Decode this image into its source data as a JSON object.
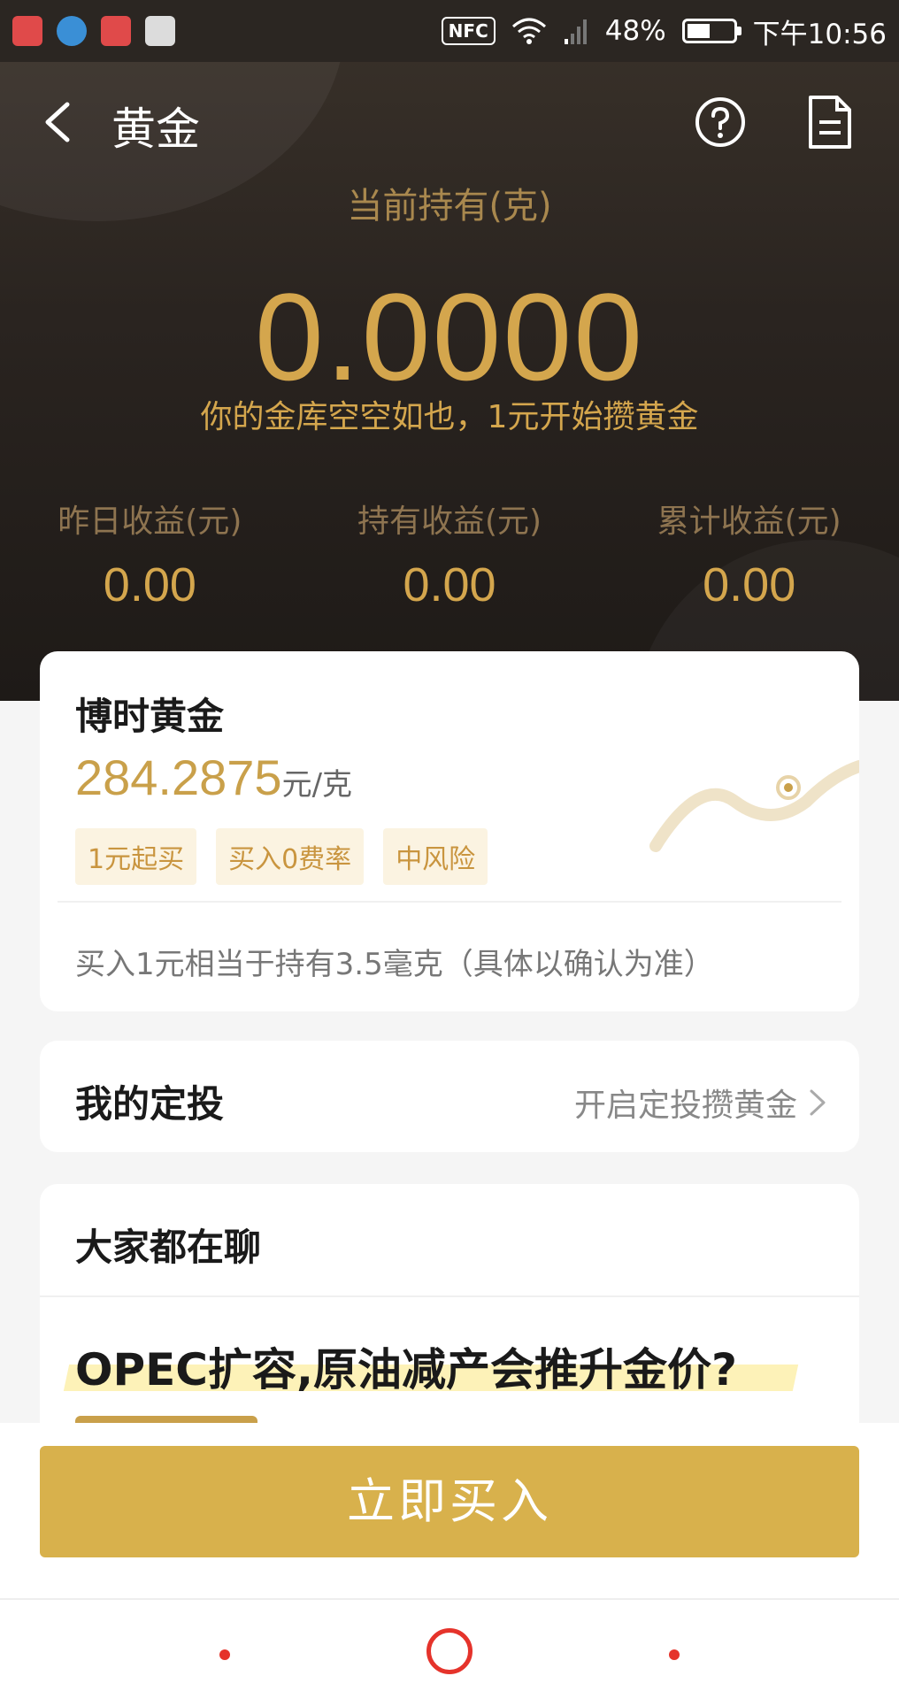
{
  "status_bar": {
    "nfc": "NFC",
    "battery": "48%",
    "time": "下午10:56",
    "app_icon_colors": [
      "#e04a4a",
      "#3a8fd6",
      "#e04a4a",
      "#dcdcdc"
    ]
  },
  "nav": {
    "title": "黄金"
  },
  "holding": {
    "label": "当前持有(克)",
    "value": "0.0000",
    "tip": "你的金库空空如也，1元开始攒黄金"
  },
  "stats": [
    {
      "label": "昨日收益(元)",
      "value": "0.00"
    },
    {
      "label": "持有收益(元)",
      "value": "0.00"
    },
    {
      "label": "累计收益(元)",
      "value": "0.00"
    }
  ],
  "gold_card": {
    "name": "博时黄金",
    "price": "284.2875",
    "unit": "元/克",
    "tags": [
      "1元起买",
      "买入0费率",
      "中风险"
    ],
    "note": "买入1元相当于持有3.5毫克（具体以确认为准）"
  },
  "invest": {
    "title": "我的定投",
    "link": "开启定投攒黄金"
  },
  "chat": {
    "title": "大家都在聊",
    "headline": "OPEC扩容,原油减产会推升金价?"
  },
  "buy_button": "立即买入",
  "colors": {
    "gold": "#d4a64d",
    "button": "#d8b14c",
    "header_bg": "#2a2420",
    "nav_red": "#e5332b"
  }
}
